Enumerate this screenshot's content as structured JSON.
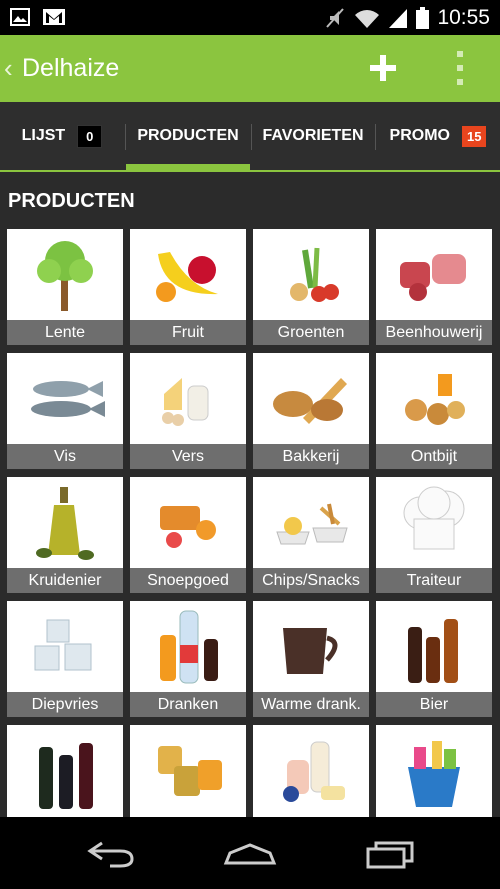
{
  "status_bar": {
    "time": "10:55"
  },
  "action_bar": {
    "title": "Delhaize"
  },
  "tabs": [
    {
      "label": "LIJST",
      "badge": "0"
    },
    {
      "label": "PRODUCTEN"
    },
    {
      "label": "FAVORIETEN"
    },
    {
      "label": "PROMO",
      "badge": "15"
    }
  ],
  "section": {
    "title": "PRODUCTEN"
  },
  "categories": [
    {
      "label": "Lente",
      "icon": "tree-icon"
    },
    {
      "label": "Fruit",
      "icon": "fruit-icon"
    },
    {
      "label": "Groenten",
      "icon": "vegetables-icon"
    },
    {
      "label": "Beenhouwerij",
      "icon": "meat-icon"
    },
    {
      "label": "Vis",
      "icon": "fish-icon"
    },
    {
      "label": "Vers",
      "icon": "dairy-icon"
    },
    {
      "label": "Bakkerij",
      "icon": "bread-icon"
    },
    {
      "label": "Ontbijt",
      "icon": "breakfast-icon"
    },
    {
      "label": "Kruidenier",
      "icon": "olive-oil-icon"
    },
    {
      "label": "Snoepgoed",
      "icon": "candy-icon"
    },
    {
      "label": "Chips/Snacks",
      "icon": "snacks-icon"
    },
    {
      "label": "Traiteur",
      "icon": "chef-hat-icon"
    },
    {
      "label": "Diepvries",
      "icon": "ice-cubes-icon"
    },
    {
      "label": "Dranken",
      "icon": "drinks-icon"
    },
    {
      "label": "Warme drank.",
      "icon": "mug-icon"
    },
    {
      "label": "Bier",
      "icon": "beer-bottles-icon"
    },
    {
      "label": "",
      "icon": "wine-bottles-icon"
    },
    {
      "label": "",
      "icon": "baby-food-jars-icon"
    },
    {
      "label": "",
      "icon": "toiletries-icon"
    },
    {
      "label": "",
      "icon": "cleaning-bucket-icon"
    }
  ],
  "colors": {
    "accent": "#8bc53f",
    "promo_badge": "#e8451e",
    "label_bar": "#6e6e6e",
    "background": "#2b2b2b"
  }
}
